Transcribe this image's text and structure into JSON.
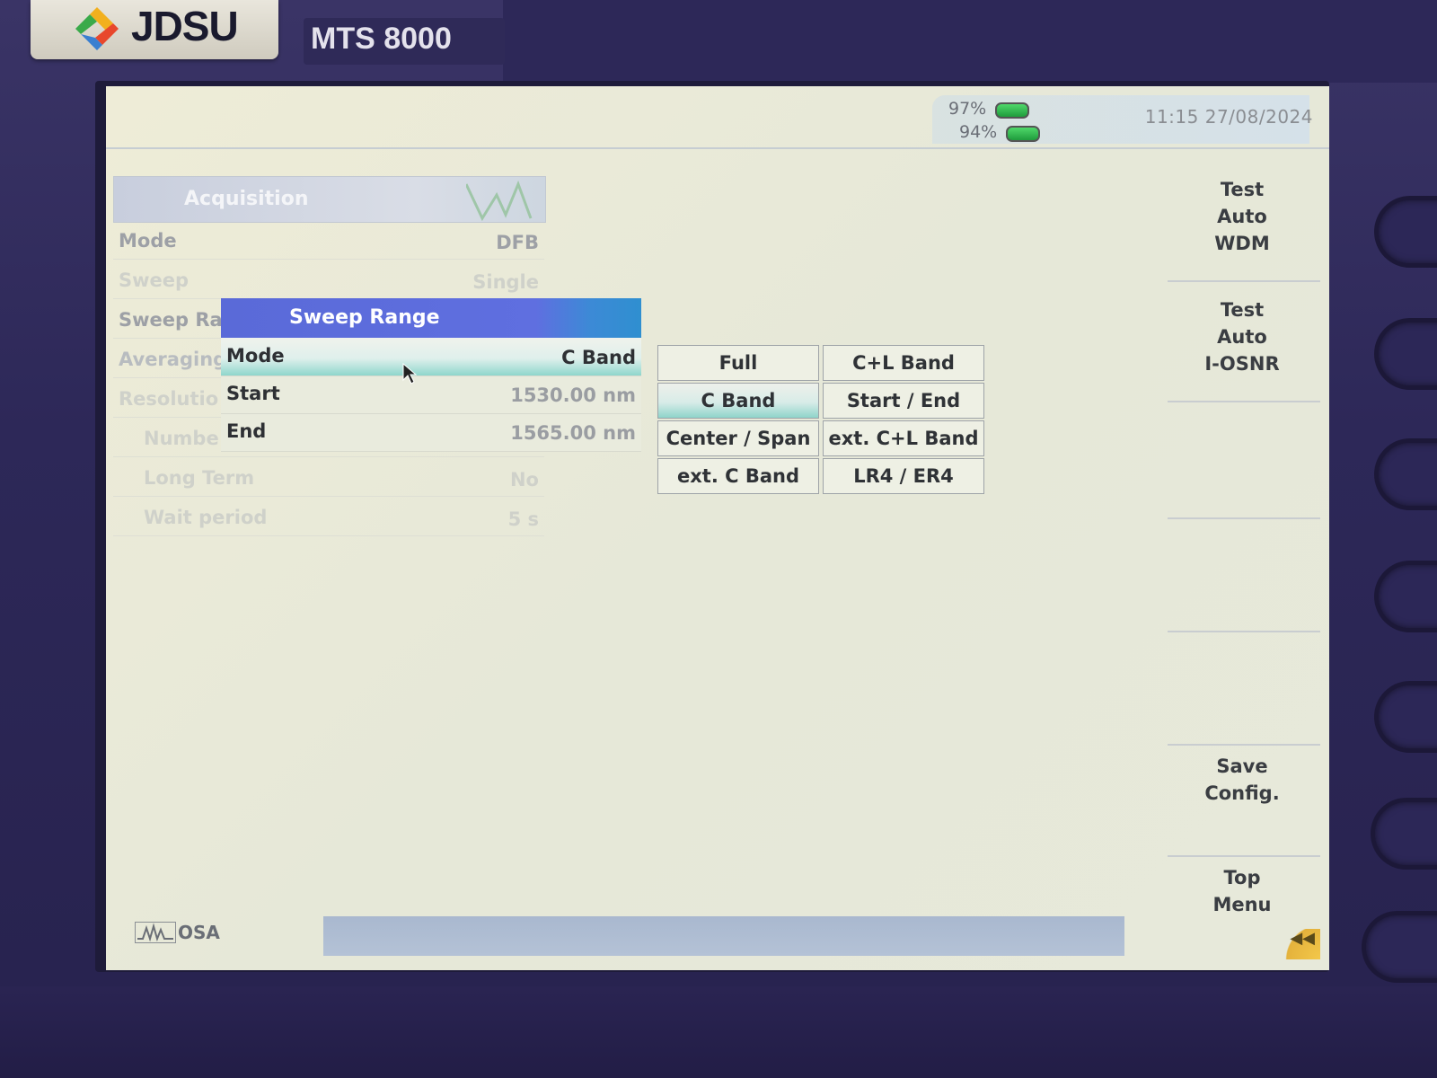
{
  "device": {
    "brand": "JDSU",
    "model": "MTS 8000"
  },
  "status": {
    "battery_1": "97%",
    "battery_2": "94%",
    "time": "11:15",
    "date": "27/08/2024"
  },
  "acquisition": {
    "title": "Acquisition",
    "rows": [
      {
        "label": "Mode",
        "value": "DFB"
      },
      {
        "label": "Sweep",
        "value": "Single"
      },
      {
        "label": "Sweep Ra",
        "value": ""
      },
      {
        "label": "Averaging",
        "value": ""
      },
      {
        "label": "Resolutio",
        "value": ""
      },
      {
        "label": "Numbe",
        "value": ""
      },
      {
        "label": "Long Term",
        "value": "No"
      },
      {
        "label": "Wait period",
        "value": "5 s"
      }
    ]
  },
  "sweep_range": {
    "title": "Sweep Range",
    "rows": [
      {
        "label": "Mode",
        "value": "C Band"
      },
      {
        "label": "Start",
        "value": "1530.00 nm"
      },
      {
        "label": "End",
        "value": "1565.00 nm"
      }
    ]
  },
  "options": [
    {
      "label": "Full"
    },
    {
      "label": "C+L Band"
    },
    {
      "label": "C Band",
      "selected": true
    },
    {
      "label": "Start / End"
    },
    {
      "label": "Center / Span"
    },
    {
      "label": "ext. C+L Band"
    },
    {
      "label": "ext. C Band"
    },
    {
      "label": "LR4 / ER4"
    }
  ],
  "menu": {
    "test_auto_wdm": [
      "Test",
      "Auto",
      "WDM"
    ],
    "test_auto_iosnr": [
      "Test",
      "Auto",
      "I-OSNR"
    ],
    "save_config": [
      "Save",
      "Config."
    ],
    "top_menu": [
      "Top",
      "Menu"
    ]
  },
  "footer": {
    "module": "OSA"
  },
  "colors": {
    "lcd_background": "#eeecd7",
    "header_blue": "#5a6ad8",
    "selection_teal": "#8fd6cc",
    "bezel": "#2d2858"
  }
}
